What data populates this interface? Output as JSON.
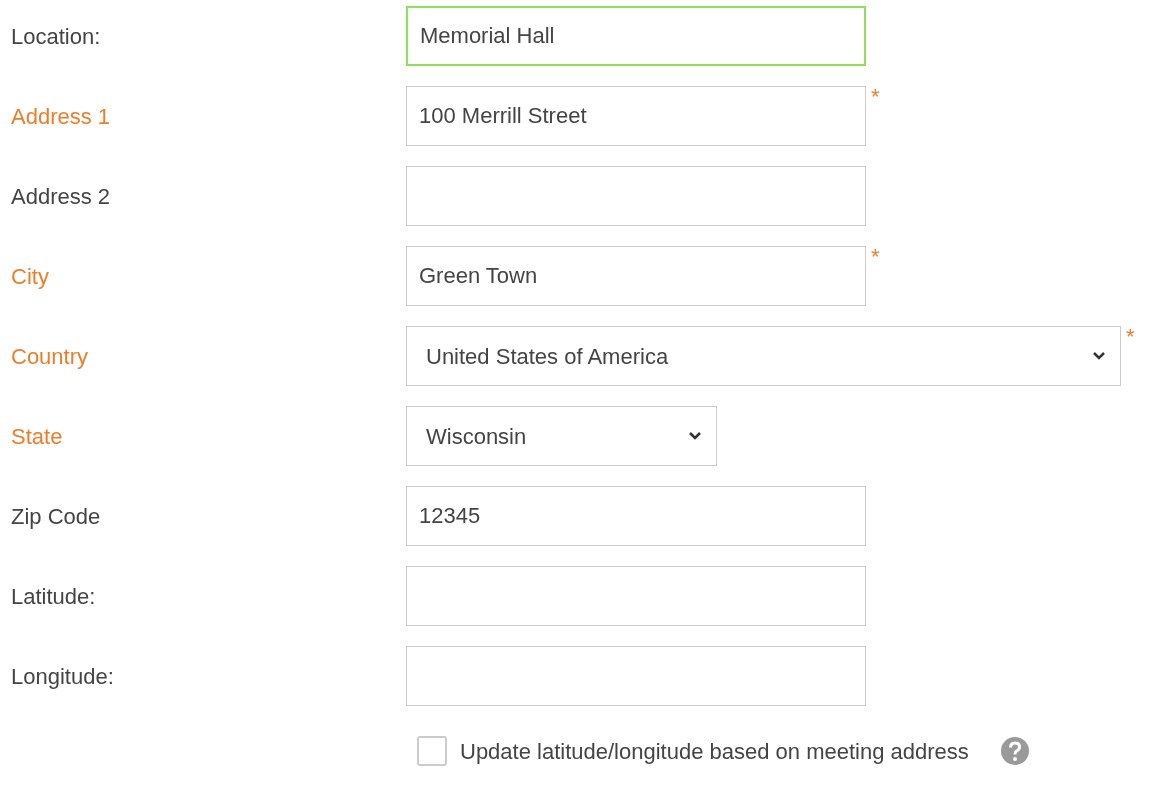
{
  "fields": [
    {
      "label": "Location:",
      "kind": "text",
      "value": "Memorial Hall",
      "required": false,
      "focused": true
    },
    {
      "label": "Address 1",
      "kind": "text",
      "value": "100 Merrill Street",
      "required": true,
      "mark": "*"
    },
    {
      "label": "Address 2",
      "kind": "text",
      "required": false
    },
    {
      "label": "City",
      "kind": "text",
      "value": "Green Town",
      "required": true,
      "mark": "*"
    },
    {
      "label": "Country",
      "kind": "wideselect",
      "value": "United States of America",
      "required": true,
      "mark": "*"
    },
    {
      "label": "State",
      "kind": "select",
      "value": "Wisconsin",
      "required": true
    },
    {
      "label": "Zip Code",
      "kind": "text",
      "value": "12345",
      "required": false
    },
    {
      "label": "Latitude:",
      "kind": "text",
      "required": false
    },
    {
      "label": "Longitude:",
      "kind": "text",
      "required": false
    }
  ],
  "update_option": {
    "label": "Update latitude/longitude based on meeting address",
    "checked": false
  }
}
